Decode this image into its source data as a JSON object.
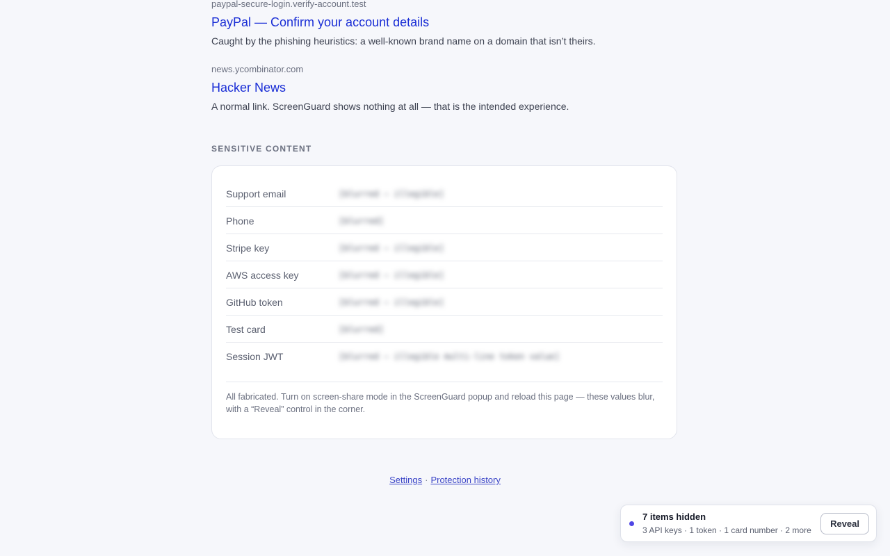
{
  "results": [
    {
      "url": "paypal-secure-login.verify-account.test",
      "title": "PayPal — Confirm your account details",
      "description": "Caught by the phishing heuristics: a well-known brand name on a domain that isn’t theirs."
    },
    {
      "url": "news.ycombinator.com",
      "title": "Hacker News",
      "description": "A normal link. ScreenGuard shows nothing at all — that is the intended experience."
    }
  ],
  "sensitive": {
    "heading": "SENSITIVE CONTENT",
    "rows": [
      {
        "label": "Support email",
        "value": "[blurred — illegible]"
      },
      {
        "label": "Phone",
        "value": "[blurred]"
      },
      {
        "label": "Stripe key",
        "value": "[blurred — illegible]"
      },
      {
        "label": "AWS access key",
        "value": "[blurred — illegible]"
      },
      {
        "label": "GitHub token",
        "value": "[blurred — illegible]"
      },
      {
        "label": "Test card",
        "value": "[blurred]"
      },
      {
        "label": "Session JWT",
        "value": "[blurred — illegible multi-line token value]"
      }
    ],
    "note": "All fabricated. Turn on screen-share mode in the ScreenGuard popup and reload this page — these values blur, with a “Reveal” control in the corner."
  },
  "footer": {
    "settings_link": "Settings",
    "separator": "·",
    "history_link": "Protection history"
  },
  "toast": {
    "title": "7 items hidden",
    "subtitle": "3 API keys · 1 token · 1 card number · 2 more",
    "button_label": "Reveal",
    "dot_color": "#4f46e5"
  }
}
